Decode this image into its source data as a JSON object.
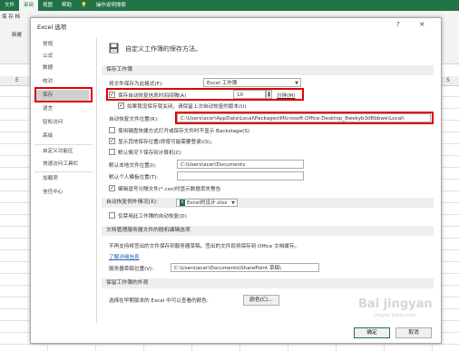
{
  "ribbon": {
    "tabs": [
      "文件",
      "审阅",
      "视图",
      "帮助",
      "操作说明搜索"
    ],
    "active_tab_index": 1,
    "search_icon": "lightbulb-icon",
    "left_buttons": [
      "新建",
      "保存"
    ],
    "partial_left_text": "保 存 档"
  },
  "sheet": {
    "columns": [
      "E",
      "S"
    ]
  },
  "dialog": {
    "title": "Excel 选项",
    "help_label": "?",
    "close_label": "×",
    "sidebar": {
      "items": [
        "常规",
        "公式",
        "数据",
        "校对",
        "保存",
        "语言",
        "轻松访问",
        "高级",
        "自定义功能区",
        "快速访问工具栏",
        "加载项",
        "信任中心"
      ],
      "active_index": 4
    },
    "header": "自定义工作簿的保存方法。",
    "save_section": {
      "title": "保存工作簿",
      "format_label": "将文件保存为此格式(F):",
      "format_value": "Excel 工作簿",
      "autorecover_label": "保存自动恢复信息时间间隔(A)",
      "autorecover_checked": true,
      "autorecover_minutes": "10",
      "minutes_label": "分钟(M)",
      "keep_last_label": "如果我没保存就关闭，请保留上次自动恢复的版本(U)",
      "keep_last_checked": true,
      "autorecover_location_label": "自动恢复文件位置(R):",
      "autorecover_location_value": "C:\\Users\\acer\\AppData\\Local\\Packages\\Microsoft.Office.Desktop_8wekyb3d8bbwe\\Local\\",
      "no_backstage_label": "使用键盘快捷方式打开或保存文件时不显示 Backstage(S)",
      "no_backstage_checked": false,
      "show_more_label": "显示其他保存位置(即使可能需要登录)(S)。",
      "show_more_checked": true,
      "default_computer_label": "默认情况下保存到计算机(C)",
      "default_computer_checked": false,
      "default_local_label": "默认本地文件位置(I):",
      "default_local_value": "C:\\Users\\acer\\Documents",
      "default_template_label": "默认个人模板位置(T):",
      "default_template_value": "",
      "csv_warning_label": "编辑逗号分隔文件(*.csv)时显示数据丢失警告",
      "csv_warning_checked": true
    },
    "exceptions_section": {
      "label": "自动恢复例外情况(X):",
      "value": "Excel的设计.xlsx",
      "disable_label": "仅禁用此工作簿的自动恢复(D)",
      "disable_checked": false
    },
    "offline_section": {
      "title": "文档管理服务器文件的脱机编辑选项",
      "note": "不再支持将签出的文件保存到服务器草稿。签出的文件现将保存到 Office 文档缓存。",
      "learn_more": "了解详细信息",
      "drafts_label": "服务器草稿位置(V):",
      "drafts_value": "C:\\Users\\acer\\Documents\\SharePoint 草稿\\"
    },
    "visual_section": {
      "title": "保留工作簿的外观",
      "colors_label": "选择在早期版本的 Excel 中可以查看的颜色:",
      "colors_button": "颜色(C)..."
    },
    "ok_button": "确定",
    "cancel_button": "取消"
  },
  "watermark": {
    "text": "Bai jingyan",
    "sub": "jingyan.baidu.com"
  },
  "colors": {
    "excel_green": "#217346",
    "highlight_red": "#e00000",
    "sidebar_active": "#cfcfcf"
  }
}
